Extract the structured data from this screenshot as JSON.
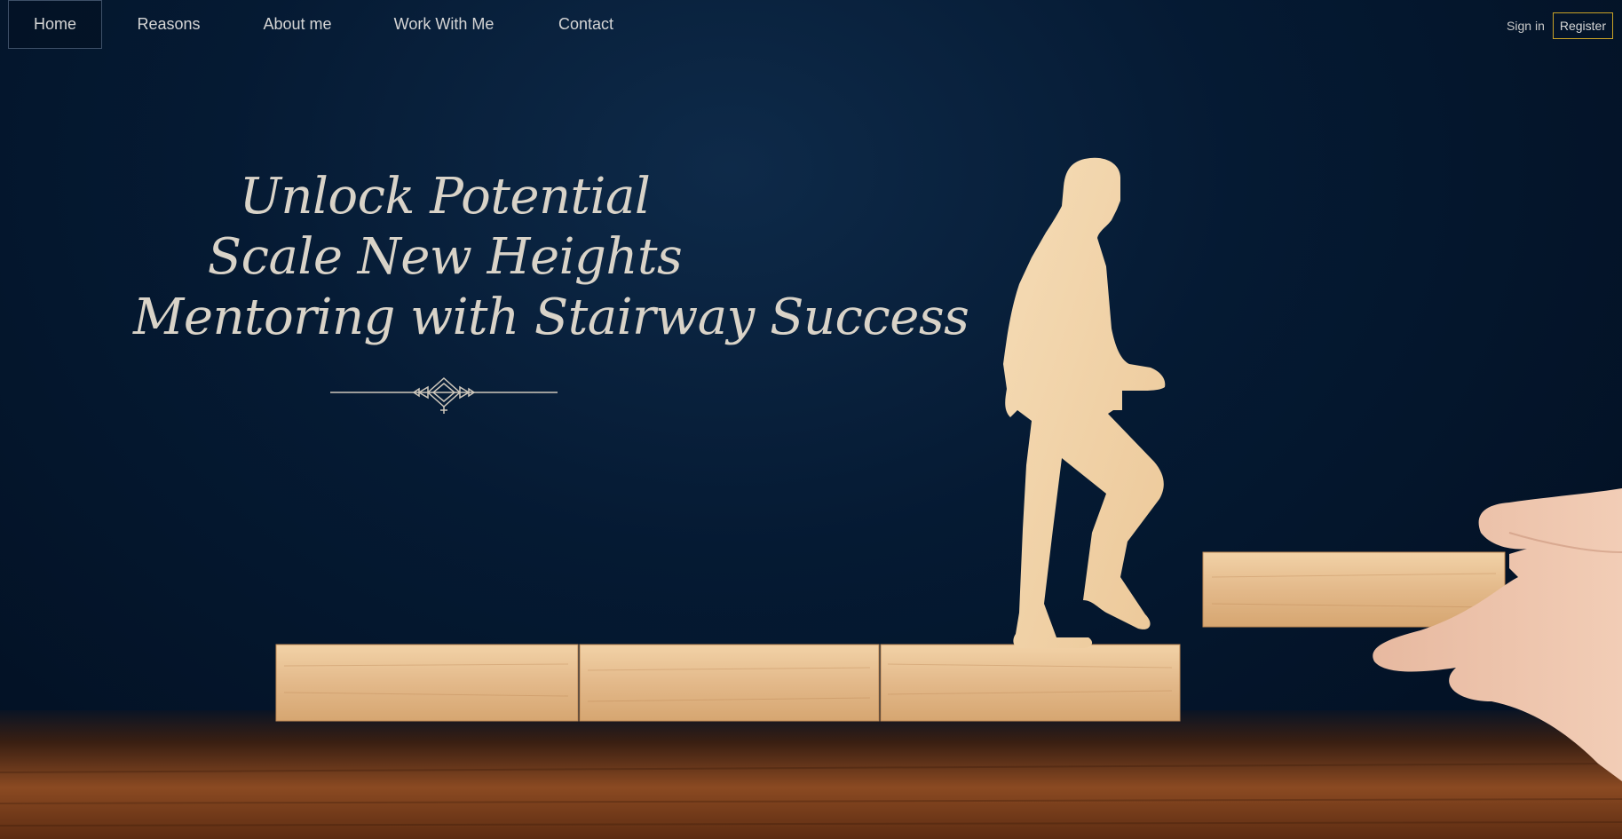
{
  "nav": {
    "items": [
      {
        "label": "Home",
        "active": true
      },
      {
        "label": "Reasons"
      },
      {
        "label": "About me"
      },
      {
        "label": "Work With Me"
      },
      {
        "label": "Contact"
      }
    ]
  },
  "auth": {
    "sign_in": "Sign in",
    "register": "Register"
  },
  "hero": {
    "line1": "Unlock Potential",
    "line2": "Scale New Heights",
    "line3": "Mentoring with Stairway Success"
  },
  "colors": {
    "background": "#031329",
    "wood": "#e3b98a",
    "register_border": "#c9a227",
    "text": "#d9d3c8"
  }
}
